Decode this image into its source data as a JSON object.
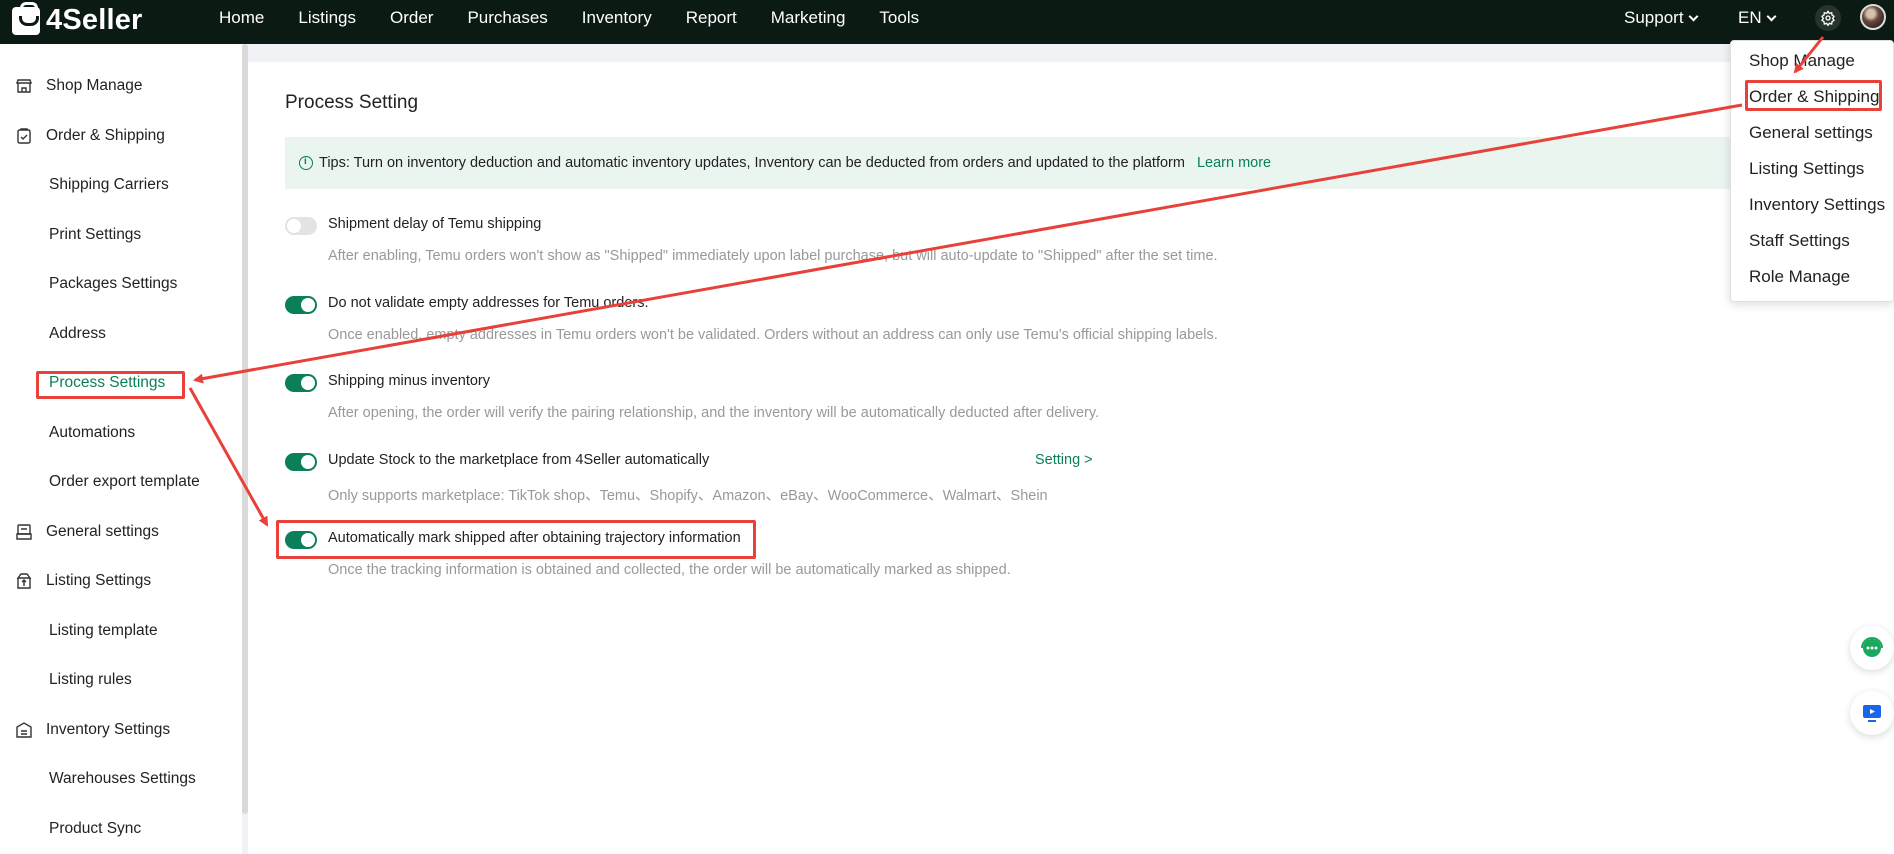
{
  "brand": {
    "name": "4Seller"
  },
  "nav": {
    "items": [
      "Home",
      "Listings",
      "Order",
      "Purchases",
      "Inventory",
      "Report",
      "Marketing",
      "Tools"
    ],
    "support_label": "Support",
    "lang_label": "EN"
  },
  "sidebar": {
    "items": [
      {
        "label": "Shop Manage",
        "level": 1,
        "icon": "store-icon"
      },
      {
        "label": "Order & Shipping",
        "level": 1,
        "icon": "clipboard-check-icon"
      },
      {
        "label": "Shipping Carriers",
        "level": 2
      },
      {
        "label": "Print Settings",
        "level": 2
      },
      {
        "label": "Packages Settings",
        "level": 2
      },
      {
        "label": "Address",
        "level": 2
      },
      {
        "label": "Process Settings",
        "level": 2,
        "active": true
      },
      {
        "label": "Automations",
        "level": 2
      },
      {
        "label": "Order export template",
        "level": 2
      },
      {
        "label": "General settings",
        "level": 1,
        "icon": "printer-icon"
      },
      {
        "label": "Listing Settings",
        "level": 1,
        "icon": "upload-box-icon"
      },
      {
        "label": "Listing template",
        "level": 2
      },
      {
        "label": "Listing rules",
        "level": 2
      },
      {
        "label": "Inventory Settings",
        "level": 1,
        "icon": "warehouse-icon"
      },
      {
        "label": "Warehouses Settings",
        "level": 2
      },
      {
        "label": "Product Sync",
        "level": 2
      }
    ]
  },
  "main": {
    "title": "Process Setting",
    "tips": {
      "text": "Tips: Turn on inventory deduction and automatic inventory updates, Inventory can be deducted from orders and updated to the platform",
      "link": "Learn more"
    },
    "options": [
      {
        "title": "Shipment delay of Temu shipping",
        "desc": "After enabling, Temu orders won't show as \"Shipped\" immediately upon label purchase, but will auto-update to \"Shipped\" after the set time.",
        "enabled": false
      },
      {
        "title": "Do not validate empty addresses for Temu orders.",
        "desc": "Once enabled, empty addresses in Temu orders won't be validated. Orders without an address can only use Temu's official shipping labels.",
        "enabled": true
      },
      {
        "title": "Shipping minus inventory",
        "desc": "After opening, the order will verify the pairing relationship, and the inventory will be automatically deducted after delivery.",
        "enabled": true
      },
      {
        "title": "Update Stock to the marketplace from 4Seller automatically",
        "desc": "Only supports marketplace: TikTok shop、Temu、Shopify、Amazon、eBay、WooCommerce、Walmart、Shein",
        "enabled": true,
        "link": "Setting >"
      },
      {
        "title": "Automatically mark shipped after obtaining trajectory information",
        "desc": "Once the tracking information is obtained and collected, the order will be automatically marked as shipped.",
        "enabled": true
      }
    ]
  },
  "settings_menu": {
    "items": [
      "Shop Manage",
      "Order & Shipping",
      "General settings",
      "Listing Settings",
      "Inventory Settings",
      "Staff Settings",
      "Role Manage"
    ]
  },
  "colors": {
    "accent": "#0a7f5a",
    "topbar": "#0c1a14",
    "annotation": "#e8403a"
  }
}
